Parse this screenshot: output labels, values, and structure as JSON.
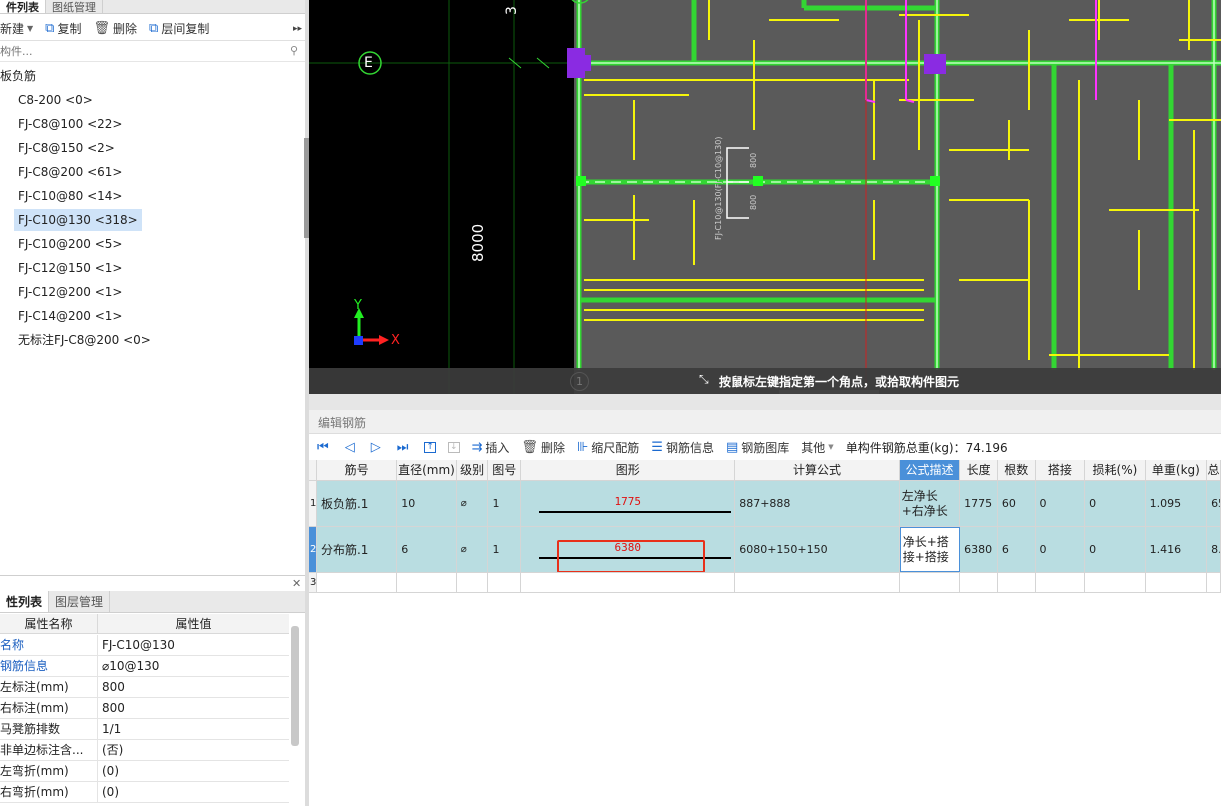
{
  "left_top": {
    "tabs": [
      "件列表",
      "图纸管理"
    ],
    "toolbar": {
      "new": "新建",
      "copy": "复制",
      "delete": "删除",
      "floor_copy": "层间复制"
    },
    "search_placeholder": "构件...",
    "tree_root": "板负筋",
    "tree_items": [
      "C8-200 <0>",
      "FJ-C8@100 <22>",
      "FJ-C8@150 <2>",
      "FJ-C8@200 <61>",
      "FJ-C10@80 <14>",
      "FJ-C10@130 <318>",
      "FJ-C10@200 <5>",
      "FJ-C12@150 <1>",
      "FJ-C12@200 <1>",
      "FJ-C14@200 <1>",
      "无标注FJ-C8@200 <0>"
    ],
    "selected_index": 5
  },
  "left_bottom": {
    "tabs": [
      "性列表",
      "图层管理"
    ],
    "header_name": "属性名称",
    "header_value": "属性值",
    "rows": [
      {
        "k": "名称",
        "v": "FJ-C10@130",
        "blue": true
      },
      {
        "k": "钢筋信息",
        "v": "⌀10@130",
        "blue": true
      },
      {
        "k": "左标注(mm)",
        "v": "800",
        "blue": false
      },
      {
        "k": "右标注(mm)",
        "v": "800",
        "blue": false
      },
      {
        "k": "马凳筋排数",
        "v": "1/1",
        "blue": false
      },
      {
        "k": "非单边标注含...",
        "v": "(否)",
        "blue": false
      },
      {
        "k": "左弯折(mm)",
        "v": "(0)",
        "blue": false
      },
      {
        "k": "右弯折(mm)",
        "v": "(0)",
        "blue": false
      }
    ]
  },
  "cad": {
    "axis_label_E": "E",
    "axis_label_1": "1",
    "dim_8000": "8000",
    "dim_top": "3",
    "rebar_label": "FJ-C10@130(FJ-C10@130)",
    "dim_800a": "800",
    "dim_800b": "800",
    "axis_y": "Y",
    "axis_x": "X",
    "status_hint": "按鼠标左键指定第一个角点，或拾取构件图元"
  },
  "editor": {
    "title": "编辑钢筋",
    "toolbar": {
      "insert": "插入",
      "delete": "删除",
      "scale": "缩尺配筋",
      "rebar_info": "钢筋信息",
      "rebar_lib": "钢筋图库",
      "other": "其他",
      "total": "单构件钢筋总重(kg)：74.196"
    },
    "columns": [
      "筋号",
      "直径(mm)",
      "级别",
      "图号",
      "图形",
      "计算公式",
      "公式描述",
      "长度",
      "根数",
      "搭接",
      "损耗(%)",
      "单重(kg)",
      "总"
    ],
    "rows": [
      {
        "idx": "1",
        "name": "板负筋.1",
        "dia": "10",
        "grade": "⌀",
        "fig": "1",
        "shape_val": "1775",
        "formula": "887+888",
        "desc": "左净长+右净长",
        "len": "1775",
        "count": "60",
        "lap": "0",
        "loss": "0",
        "unit": "1.095",
        "total": "65."
      },
      {
        "idx": "2",
        "name": "分布筋.1",
        "dia": "6",
        "grade": "⌀",
        "fig": "1",
        "shape_val": "6380",
        "formula": "6080+150+150",
        "desc": "净长+搭接+搭接",
        "len": "6380",
        "count": "6",
        "lap": "0",
        "loss": "0",
        "unit": "1.416",
        "total": "8."
      },
      {
        "idx": "3"
      }
    ]
  }
}
